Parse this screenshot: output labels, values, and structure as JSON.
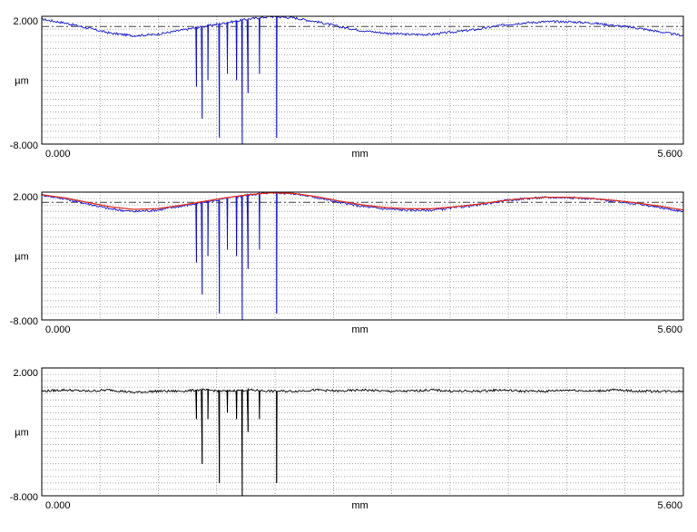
{
  "chart_data": [
    {
      "type": "line",
      "title": "",
      "xlabel": "mm",
      "ylabel": "µm",
      "xlim": [
        0,
        5.6
      ],
      "ylim": [
        -8,
        2
      ],
      "x_tick_labels": [
        "0.000",
        "5.600"
      ],
      "y_tick_labels": [
        "2.000",
        "-8.000"
      ],
      "grid": true,
      "reference_line": 1.2,
      "series": [
        {
          "color": "#1a1ad0",
          "x": [
            0.0,
            0.2,
            0.4,
            0.6,
            0.8,
            1.0,
            1.2,
            1.4,
            1.6,
            1.8,
            2.0,
            2.2,
            2.4,
            2.6,
            2.8,
            3.0,
            3.2,
            3.4,
            3.6,
            3.8,
            4.0,
            4.2,
            4.4,
            4.6,
            4.8,
            5.0,
            5.2,
            5.4,
            5.6
          ],
          "values": [
            1.8,
            1.5,
            1.1,
            0.7,
            0.5,
            0.6,
            0.9,
            1.2,
            1.5,
            1.8,
            2.0,
            1.9,
            1.6,
            1.2,
            0.9,
            0.7,
            0.6,
            0.6,
            0.8,
            1.0,
            1.3,
            1.5,
            1.6,
            1.6,
            1.5,
            1.3,
            1.1,
            0.8,
            0.5
          ],
          "drops": [
            {
              "x": 1.35,
              "y": -3.5
            },
            {
              "x": 1.4,
              "y": -6.0
            },
            {
              "x": 1.45,
              "y": -3.0
            },
            {
              "x": 1.55,
              "y": -7.5
            },
            {
              "x": 1.62,
              "y": -2.5
            },
            {
              "x": 1.7,
              "y": -3.0
            },
            {
              "x": 1.75,
              "y": -8.0
            },
            {
              "x": 1.8,
              "y": -4.0
            },
            {
              "x": 1.9,
              "y": -2.5
            },
            {
              "x": 2.05,
              "y": -7.5
            }
          ]
        }
      ]
    },
    {
      "type": "line",
      "title": "",
      "xlabel": "mm",
      "ylabel": "µm",
      "xlim": [
        0,
        5.6
      ],
      "ylim": [
        -8,
        2
      ],
      "x_tick_labels": [
        "0.000",
        "5.600"
      ],
      "y_tick_labels": [
        "2.000",
        "-8.000"
      ],
      "grid": true,
      "reference_line": 1.2,
      "series": [
        {
          "color": "#1a1ad0",
          "x": [
            0.0,
            0.2,
            0.4,
            0.6,
            0.8,
            1.0,
            1.2,
            1.4,
            1.6,
            1.8,
            2.0,
            2.2,
            2.4,
            2.6,
            2.8,
            3.0,
            3.2,
            3.4,
            3.6,
            3.8,
            4.0,
            4.2,
            4.4,
            4.6,
            4.8,
            5.0,
            5.2,
            5.4,
            5.6
          ],
          "values": [
            1.8,
            1.5,
            1.1,
            0.7,
            0.5,
            0.6,
            0.9,
            1.2,
            1.5,
            1.8,
            2.0,
            1.9,
            1.6,
            1.2,
            0.9,
            0.7,
            0.6,
            0.6,
            0.8,
            1.0,
            1.3,
            1.5,
            1.6,
            1.6,
            1.5,
            1.3,
            1.1,
            0.8,
            0.5
          ],
          "drops": [
            {
              "x": 1.35,
              "y": -3.5
            },
            {
              "x": 1.4,
              "y": -6.0
            },
            {
              "x": 1.45,
              "y": -3.0
            },
            {
              "x": 1.55,
              "y": -7.5
            },
            {
              "x": 1.62,
              "y": -2.5
            },
            {
              "x": 1.7,
              "y": -3.0
            },
            {
              "x": 1.75,
              "y": -8.0
            },
            {
              "x": 1.8,
              "y": -4.0
            },
            {
              "x": 1.9,
              "y": -2.5
            },
            {
              "x": 2.05,
              "y": -7.5
            }
          ]
        },
        {
          "color": "#e03020",
          "x": [
            0.0,
            0.2,
            0.4,
            0.6,
            0.8,
            1.0,
            1.2,
            1.4,
            1.6,
            1.8,
            2.0,
            2.2,
            2.4,
            2.6,
            2.8,
            3.0,
            3.2,
            3.4,
            3.6,
            3.8,
            4.0,
            4.2,
            4.4,
            4.6,
            4.8,
            5.0,
            5.2,
            5.4,
            5.6
          ],
          "values": [
            1.8,
            1.55,
            1.2,
            0.85,
            0.65,
            0.7,
            0.95,
            1.25,
            1.55,
            1.8,
            1.95,
            1.9,
            1.65,
            1.3,
            1.0,
            0.8,
            0.7,
            0.7,
            0.85,
            1.05,
            1.3,
            1.5,
            1.6,
            1.6,
            1.5,
            1.35,
            1.15,
            0.9,
            0.6
          ],
          "drops": []
        }
      ]
    },
    {
      "type": "line",
      "title": "",
      "xlabel": "mm",
      "ylabel": "µm",
      "xlim": [
        0,
        5.6
      ],
      "ylim": [
        -8,
        2
      ],
      "x_tick_labels": [
        "0.000",
        "5.600"
      ],
      "y_tick_labels": [
        "2.000",
        "-8.000"
      ],
      "grid": true,
      "reference_line": null,
      "series": [
        {
          "color": "#000000",
          "x": [
            0.0,
            0.2,
            0.4,
            0.6,
            0.8,
            1.0,
            1.2,
            1.4,
            1.6,
            1.8,
            2.0,
            2.2,
            2.4,
            2.6,
            2.8,
            3.0,
            3.2,
            3.4,
            3.6,
            3.8,
            4.0,
            4.2,
            4.4,
            4.6,
            4.8,
            5.0,
            5.2,
            5.4,
            5.6
          ],
          "values": [
            0.2,
            0.3,
            0.2,
            0.3,
            0.1,
            0.2,
            0.2,
            0.3,
            0.2,
            0.3,
            0.2,
            0.2,
            0.3,
            0.2,
            0.3,
            0.2,
            0.2,
            0.3,
            0.2,
            0.2,
            0.3,
            0.2,
            0.2,
            0.3,
            0.2,
            0.3,
            0.2,
            0.2,
            0.2
          ],
          "drops": [
            {
              "x": 1.35,
              "y": -2.0
            },
            {
              "x": 1.4,
              "y": -5.5
            },
            {
              "x": 1.45,
              "y": -2.0
            },
            {
              "x": 1.55,
              "y": -7.0
            },
            {
              "x": 1.62,
              "y": -1.5
            },
            {
              "x": 1.7,
              "y": -2.0
            },
            {
              "x": 1.75,
              "y": -8.0
            },
            {
              "x": 1.8,
              "y": -3.0
            },
            {
              "x": 1.9,
              "y": -2.0
            },
            {
              "x": 2.05,
              "y": -7.0
            }
          ]
        }
      ]
    }
  ]
}
